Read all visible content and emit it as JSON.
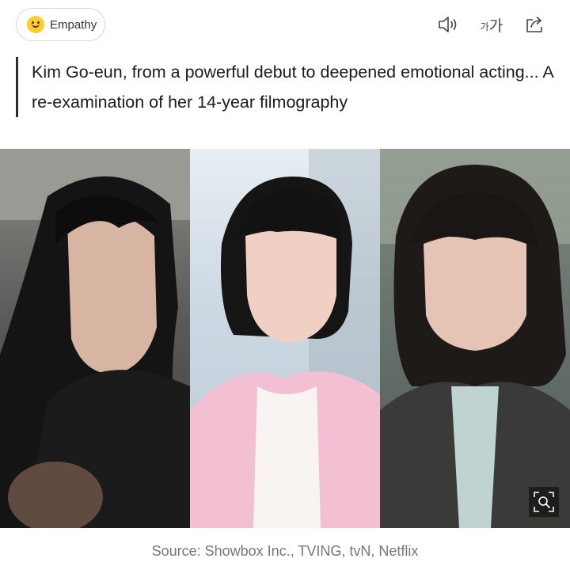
{
  "toolbar": {
    "empathy_label": "Empathy",
    "font_small": "가",
    "font_big": "가"
  },
  "article": {
    "headline": "Kim Go-eun, from a powerful debut to deepened emotional acting... A re-examination of her 14-year filmography"
  },
  "image": {
    "caption": "Source: Showbox Inc., TVING, tvN, Netflix"
  },
  "colors": {
    "empathy_smiley": "#ffcc2e",
    "caption_text": "#777777"
  }
}
